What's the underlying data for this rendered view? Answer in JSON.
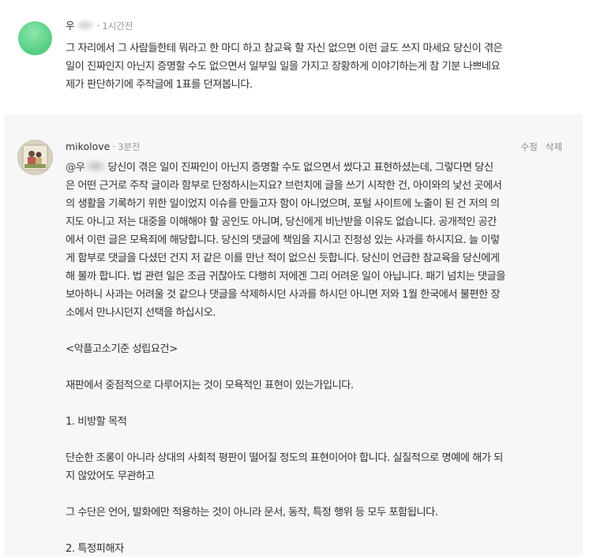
{
  "comment1": {
    "author_initial": "우",
    "time": "1시간전",
    "lines": [
      "그 자리에서 그 사람들한테 뭐라고 한 마디 하고 참교육 할 자신 없으면 이런 글도 쓰지 마세요 당신이 겪은",
      "일이 진짜인지 아닌지 증명할 수도 없으면서 일부일 일을 가지고 장황하게 이야기하는게 참 기분 나쁘네요",
      "제가 판단하기에 주작글에 1표를 던져봅니다."
    ]
  },
  "comment2": {
    "author": "mikolove",
    "time": "3분전",
    "actions": {
      "edit": "수정",
      "delete": "삭제"
    },
    "mention_prefix": "@우",
    "first_line_rest": "당신이 겪은 일이 진짜인이 아닌지 증명할 수도 없으면서 썼다고 표현하셨는데, 그렇다면 당신",
    "lines": [
      "은 어떤 근거로 주작 글이라 함부로 단정하시는지요? 브런치에 글을 쓰기 시작한 건, 아이와의 낯선 곳에서",
      "의 생활을 기록하기 위한 일이었지 이슈를 만들고자 함이 아니었으며, 포털 사이트에 노출이 된 건 저의 의",
      "지도 아니고 저는 대중을 이해해야 할 공인도 아니며, 당신에게 비난받을 이유도 없습니다. 공개적인 공간",
      "에서 이런 글은 모욕죄에 해당합니다. 당신의 댓글에 책임을 지시고 진정성 있는 사과를 하시지요. 늘 이렇",
      "게 함부로 댓글을 다셨던 건지 저 같은 이를 만난 적이 없으신 듯합니다. 당신이 언급한 참교육을 당신에게",
      "해 볼까 합니다. 법 관련 일은 조금 귀찮아도 다행히 저에겐 그리 어려운 일이 아닙니다. 패기 넘치는 댓글을",
      "보아하니 사과는 어려울 것 같으나 댓글을 삭제하시던 사과를 하시던 아니면 저와 1월 한국에서 불편한 장",
      "소에서 만나시던지 선택을 하십시오."
    ],
    "section_title": "<악플고소기준 성립요건>",
    "intro": "재판에서 중점적으로 다루어지는 것이 모욕적인 표현이 있는가입니다.",
    "item1_title": "1. 비방할 목적",
    "item1_text_1": "단순한 조롱이 아니라 상대의 사회적 평판이 떨어질 정도의 표현이어야 합니다. 실질적으로 명예에 해가 되",
    "item1_text_2": "지 않았어도 무관하고",
    "item1_text_3": "그 수단은 언어, 발화에만 적용하는 것이 아니라 문서, 동작, 특정 행위 등 모두 포함됩니다.",
    "item2_title": "2. 특정피해자"
  }
}
